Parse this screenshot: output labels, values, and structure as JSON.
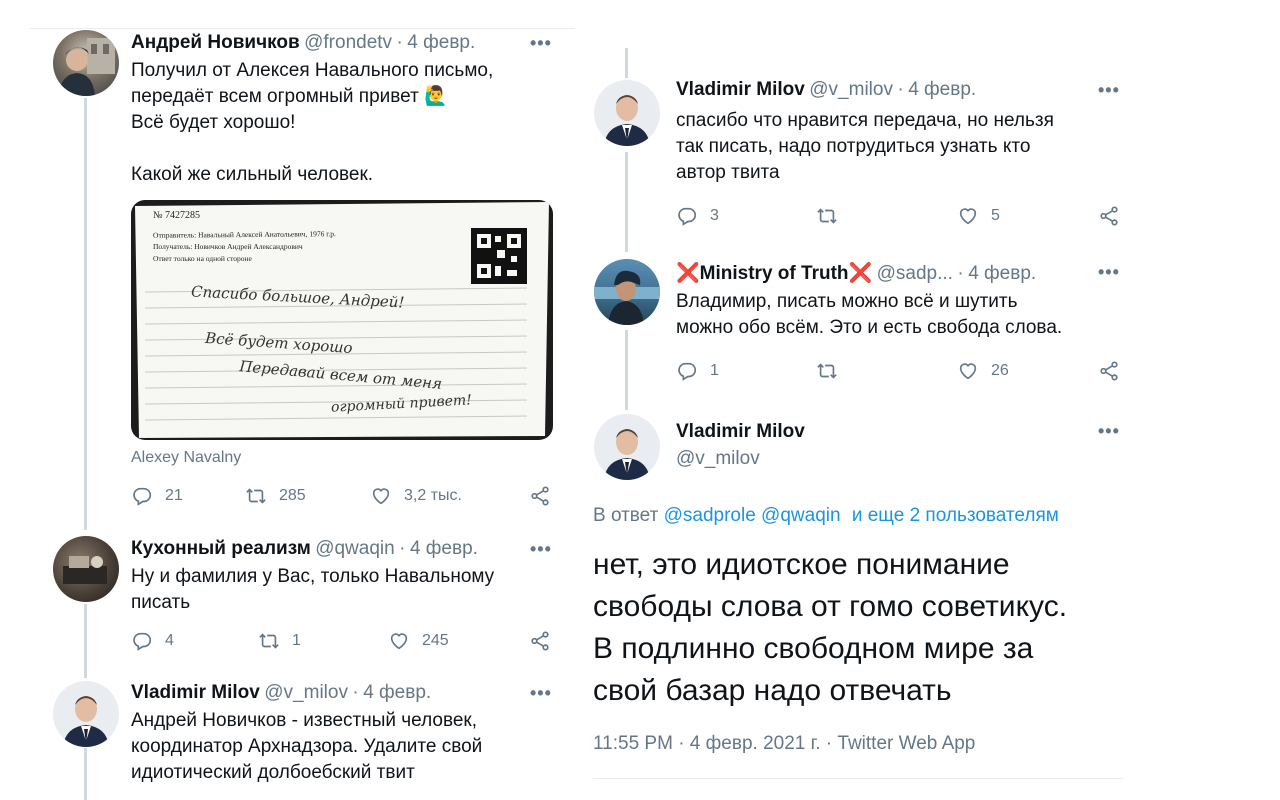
{
  "left": {
    "tweets": [
      {
        "name": "Андрей Новичков",
        "handle": "@frondetv",
        "date": "4 февр.",
        "text": "Получил от Алексея Навального письмо,\nпередаёт всем огромный привет 🙋‍♂️\nВсё будет хорошо!\n\nКакой же сильный человек.",
        "image_caption": "Alexey Navalny",
        "letter": {
          "number": "№ 7427285",
          "sender": "Отправитель: Навальный Алексей Анатольевич, 1976 г.р.",
          "recipient": "Получатель: Новичков Андрей Александрович",
          "note": "Ответ только на одной стороне",
          "handwriting": [
            "Спасибо большое, Андрей!",
            "Всё будет хорошо",
            "Передавай всем от меня",
            "огромный привет!"
          ]
        },
        "replies": "21",
        "retweets": "285",
        "likes": "3,2 тыс."
      },
      {
        "name": "Кухонный реализм",
        "handle": "@qwaqin",
        "date": "4 февр.",
        "text": "Ну и фамилия у Вас, только Навальному\nписать",
        "replies": "4",
        "retweets": "1",
        "likes": "245"
      },
      {
        "name": "Vladimir Milov",
        "handle": "@v_milov",
        "date": "4 февр.",
        "text": "Андрей Новичков - известный человек,\nкоординатор Архнадзора. Удалите свой\nидиотический долбоебский твит"
      }
    ]
  },
  "right": {
    "tweets": [
      {
        "name": "Vladimir Milov",
        "handle": "@v_milov",
        "date": "4 февр.",
        "text": "спасибо что нравится передача, но нельзя\nтак писать, надо потрудиться узнать кто\nавтор твита",
        "replies": "3",
        "retweets": "",
        "likes": "5"
      },
      {
        "name_prefix": "❌",
        "name": "Ministry of Truth",
        "name_suffix": "❌",
        "handle": "@sadp...",
        "date": "4 февр.",
        "text": "Владимир, писать можно всё и шутить\nможно обо всём. Это и есть свобода слова.",
        "replies": "1",
        "retweets": "",
        "likes": "26"
      }
    ],
    "main": {
      "name": "Vladimir Milov",
      "handle": "@v_milov",
      "reply_prefix": "В ответ",
      "reply_users": "@sadprole @qwaqin",
      "reply_more": "и еще 2 пользователям",
      "text": "нет, это идиотское понимание\nсвободы слова от гомо советикус.\nВ подлинно свободном мире за\nсвой базар надо отвечать",
      "timestamp": "11:55 PM · 4 февр. 2021 г. · Twitter Web App"
    }
  },
  "dots": "•••",
  "colors": {
    "meta": "#657786",
    "link": "#1b95e0",
    "thread": "#cfd9de",
    "cross": "#e0245e"
  }
}
